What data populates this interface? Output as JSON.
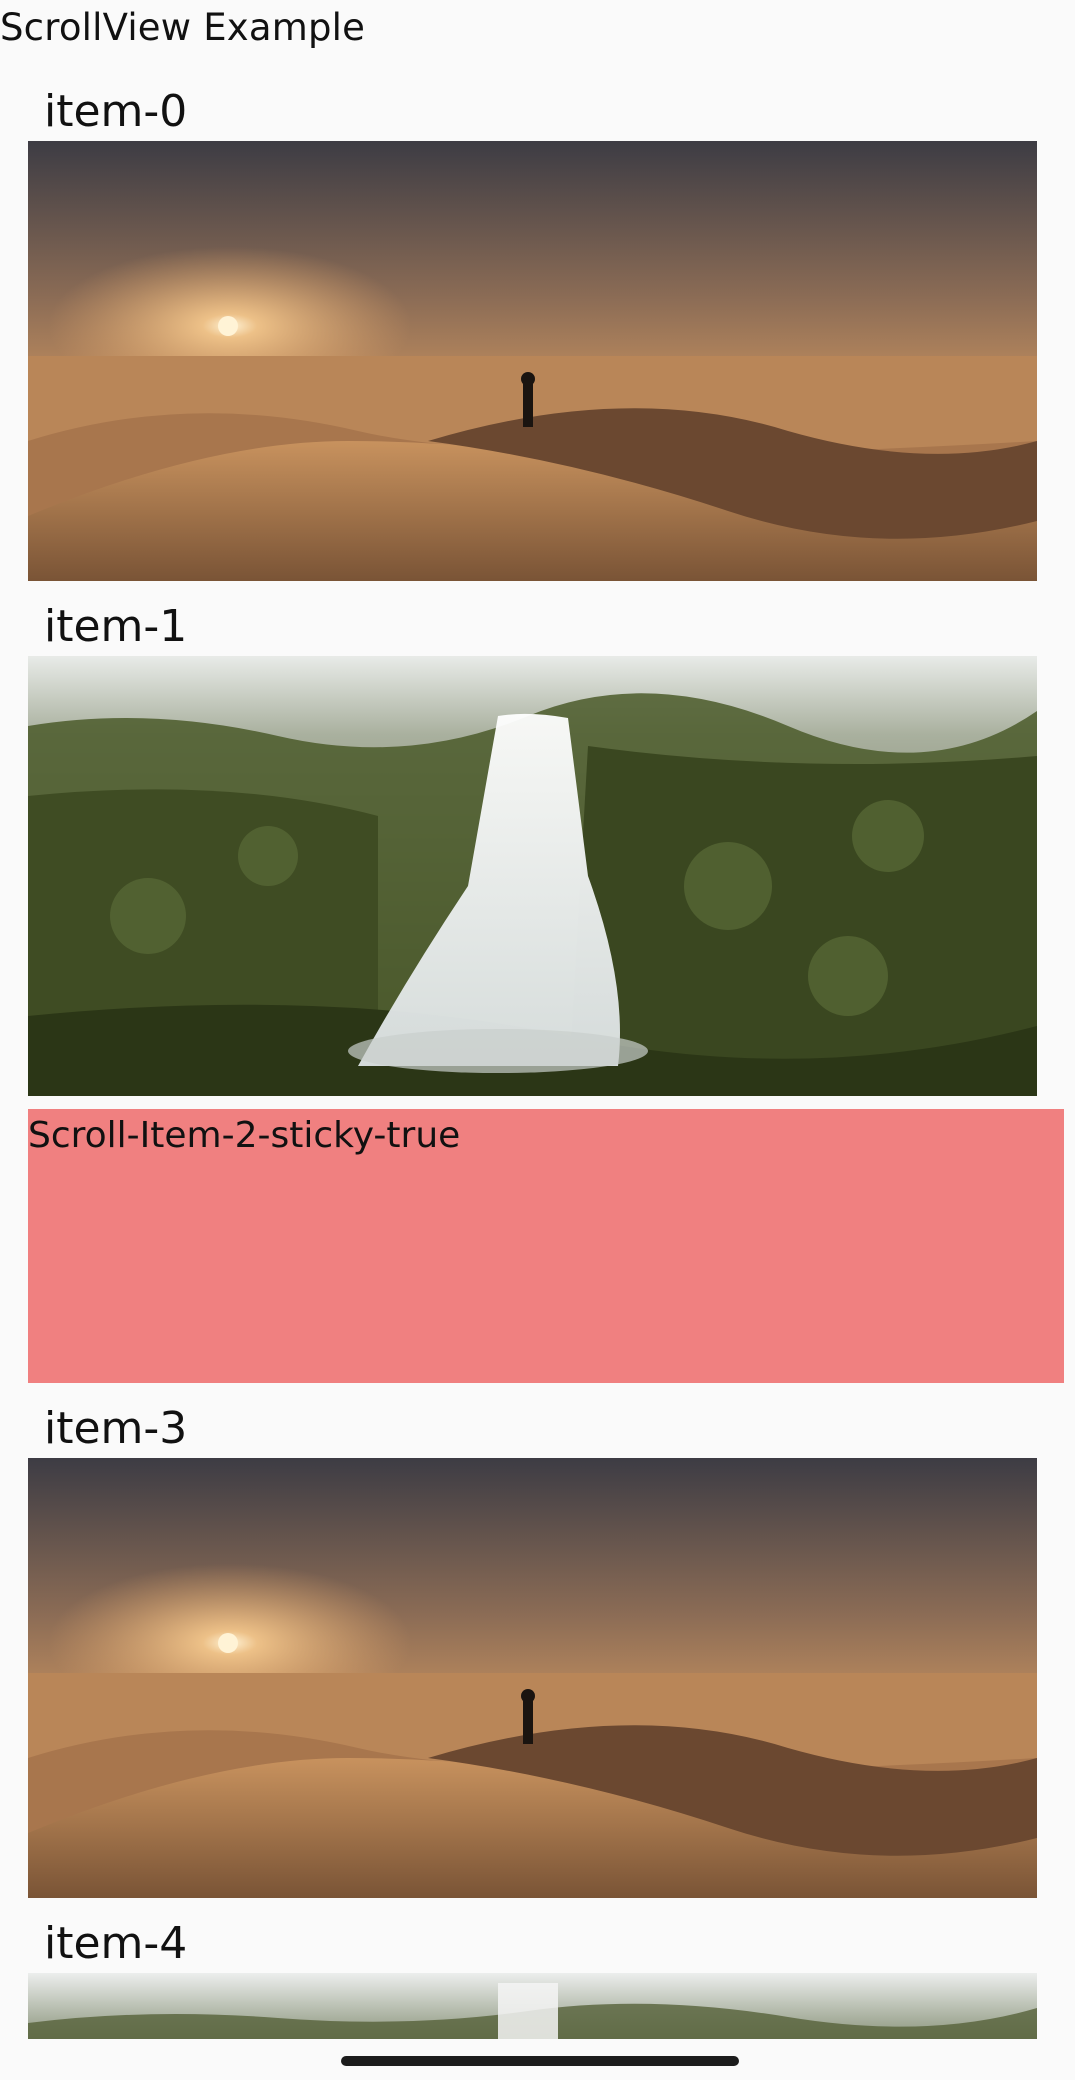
{
  "page": {
    "title": "ScrollView Example"
  },
  "items": [
    {
      "label": "item-0",
      "image": "desert-dune-sunset"
    },
    {
      "label": "item-1",
      "image": "forest-waterfall"
    },
    {
      "label": "Scroll-Item-2-sticky-true",
      "sticky": true,
      "background": "#f08080"
    },
    {
      "label": "item-3",
      "image": "desert-dune-sunset"
    },
    {
      "label": "item-4",
      "image": "forest-waterfall"
    }
  ],
  "colors": {
    "background": "#fafafa",
    "sticky_background": "#f08080",
    "text": "#111111"
  }
}
